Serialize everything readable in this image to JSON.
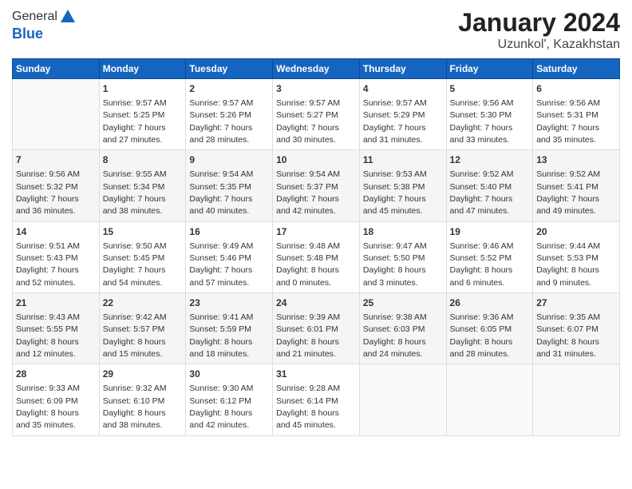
{
  "header": {
    "logo_line1": "General",
    "logo_line2": "Blue",
    "main_title": "January 2024",
    "subtitle": "Uzunkol', Kazakhstan"
  },
  "calendar": {
    "headers": [
      "Sunday",
      "Monday",
      "Tuesday",
      "Wednesday",
      "Thursday",
      "Friday",
      "Saturday"
    ],
    "weeks": [
      [
        {
          "day": "",
          "info": ""
        },
        {
          "day": "1",
          "info": "Sunrise: 9:57 AM\nSunset: 5:25 PM\nDaylight: 7 hours\nand 27 minutes."
        },
        {
          "day": "2",
          "info": "Sunrise: 9:57 AM\nSunset: 5:26 PM\nDaylight: 7 hours\nand 28 minutes."
        },
        {
          "day": "3",
          "info": "Sunrise: 9:57 AM\nSunset: 5:27 PM\nDaylight: 7 hours\nand 30 minutes."
        },
        {
          "day": "4",
          "info": "Sunrise: 9:57 AM\nSunset: 5:29 PM\nDaylight: 7 hours\nand 31 minutes."
        },
        {
          "day": "5",
          "info": "Sunrise: 9:56 AM\nSunset: 5:30 PM\nDaylight: 7 hours\nand 33 minutes."
        },
        {
          "day": "6",
          "info": "Sunrise: 9:56 AM\nSunset: 5:31 PM\nDaylight: 7 hours\nand 35 minutes."
        }
      ],
      [
        {
          "day": "7",
          "info": "Sunrise: 9:56 AM\nSunset: 5:32 PM\nDaylight: 7 hours\nand 36 minutes."
        },
        {
          "day": "8",
          "info": "Sunrise: 9:55 AM\nSunset: 5:34 PM\nDaylight: 7 hours\nand 38 minutes."
        },
        {
          "day": "9",
          "info": "Sunrise: 9:54 AM\nSunset: 5:35 PM\nDaylight: 7 hours\nand 40 minutes."
        },
        {
          "day": "10",
          "info": "Sunrise: 9:54 AM\nSunset: 5:37 PM\nDaylight: 7 hours\nand 42 minutes."
        },
        {
          "day": "11",
          "info": "Sunrise: 9:53 AM\nSunset: 5:38 PM\nDaylight: 7 hours\nand 45 minutes."
        },
        {
          "day": "12",
          "info": "Sunrise: 9:52 AM\nSunset: 5:40 PM\nDaylight: 7 hours\nand 47 minutes."
        },
        {
          "day": "13",
          "info": "Sunrise: 9:52 AM\nSunset: 5:41 PM\nDaylight: 7 hours\nand 49 minutes."
        }
      ],
      [
        {
          "day": "14",
          "info": "Sunrise: 9:51 AM\nSunset: 5:43 PM\nDaylight: 7 hours\nand 52 minutes."
        },
        {
          "day": "15",
          "info": "Sunrise: 9:50 AM\nSunset: 5:45 PM\nDaylight: 7 hours\nand 54 minutes."
        },
        {
          "day": "16",
          "info": "Sunrise: 9:49 AM\nSunset: 5:46 PM\nDaylight: 7 hours\nand 57 minutes."
        },
        {
          "day": "17",
          "info": "Sunrise: 9:48 AM\nSunset: 5:48 PM\nDaylight: 8 hours\nand 0 minutes."
        },
        {
          "day": "18",
          "info": "Sunrise: 9:47 AM\nSunset: 5:50 PM\nDaylight: 8 hours\nand 3 minutes."
        },
        {
          "day": "19",
          "info": "Sunrise: 9:46 AM\nSunset: 5:52 PM\nDaylight: 8 hours\nand 6 minutes."
        },
        {
          "day": "20",
          "info": "Sunrise: 9:44 AM\nSunset: 5:53 PM\nDaylight: 8 hours\nand 9 minutes."
        }
      ],
      [
        {
          "day": "21",
          "info": "Sunrise: 9:43 AM\nSunset: 5:55 PM\nDaylight: 8 hours\nand 12 minutes."
        },
        {
          "day": "22",
          "info": "Sunrise: 9:42 AM\nSunset: 5:57 PM\nDaylight: 8 hours\nand 15 minutes."
        },
        {
          "day": "23",
          "info": "Sunrise: 9:41 AM\nSunset: 5:59 PM\nDaylight: 8 hours\nand 18 minutes."
        },
        {
          "day": "24",
          "info": "Sunrise: 9:39 AM\nSunset: 6:01 PM\nDaylight: 8 hours\nand 21 minutes."
        },
        {
          "day": "25",
          "info": "Sunrise: 9:38 AM\nSunset: 6:03 PM\nDaylight: 8 hours\nand 24 minutes."
        },
        {
          "day": "26",
          "info": "Sunrise: 9:36 AM\nSunset: 6:05 PM\nDaylight: 8 hours\nand 28 minutes."
        },
        {
          "day": "27",
          "info": "Sunrise: 9:35 AM\nSunset: 6:07 PM\nDaylight: 8 hours\nand 31 minutes."
        }
      ],
      [
        {
          "day": "28",
          "info": "Sunrise: 9:33 AM\nSunset: 6:09 PM\nDaylight: 8 hours\nand 35 minutes."
        },
        {
          "day": "29",
          "info": "Sunrise: 9:32 AM\nSunset: 6:10 PM\nDaylight: 8 hours\nand 38 minutes."
        },
        {
          "day": "30",
          "info": "Sunrise: 9:30 AM\nSunset: 6:12 PM\nDaylight: 8 hours\nand 42 minutes."
        },
        {
          "day": "31",
          "info": "Sunrise: 9:28 AM\nSunset: 6:14 PM\nDaylight: 8 hours\nand 45 minutes."
        },
        {
          "day": "",
          "info": ""
        },
        {
          "day": "",
          "info": ""
        },
        {
          "day": "",
          "info": ""
        }
      ]
    ]
  }
}
